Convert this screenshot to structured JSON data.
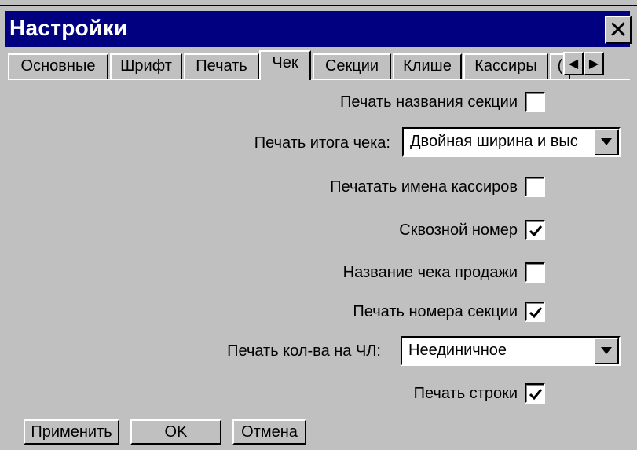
{
  "window": {
    "title": "Настройки",
    "close_icon": "close-icon"
  },
  "tabs": [
    {
      "label": "Основные",
      "active": false
    },
    {
      "label": "Шрифт",
      "active": false
    },
    {
      "label": "Печать",
      "active": false
    },
    {
      "label": "Чек",
      "active": true
    },
    {
      "label": "Секции",
      "active": false
    },
    {
      "label": "Клише",
      "active": false
    },
    {
      "label": "Кассиры",
      "active": false
    },
    {
      "label": "(",
      "active": false
    }
  ],
  "settings": {
    "print_section_name": {
      "label": "Печать названия секции",
      "checked": false
    },
    "print_total": {
      "label": "Печать итога чека:",
      "value": "Двойная ширина и выс"
    },
    "print_cashier_names": {
      "label": "Печатать имена кассиров",
      "checked": false
    },
    "through_number": {
      "label": "Сквозной номер",
      "checked": true
    },
    "sale_receipt_name": {
      "label": "Название чека продажи",
      "checked": false
    },
    "print_section_number": {
      "label": "Печать номера секции",
      "checked": true
    },
    "print_qty": {
      "label": "Печать кол-ва на ЧЛ:",
      "value": "Неединичное"
    },
    "print_line": {
      "label": "Печать строки",
      "checked": true
    }
  },
  "buttons": {
    "apply": "Применить",
    "ok": "OK",
    "cancel": "Отмена"
  },
  "colors": {
    "titlebar": "#000080",
    "face": "#c0c0c0"
  }
}
